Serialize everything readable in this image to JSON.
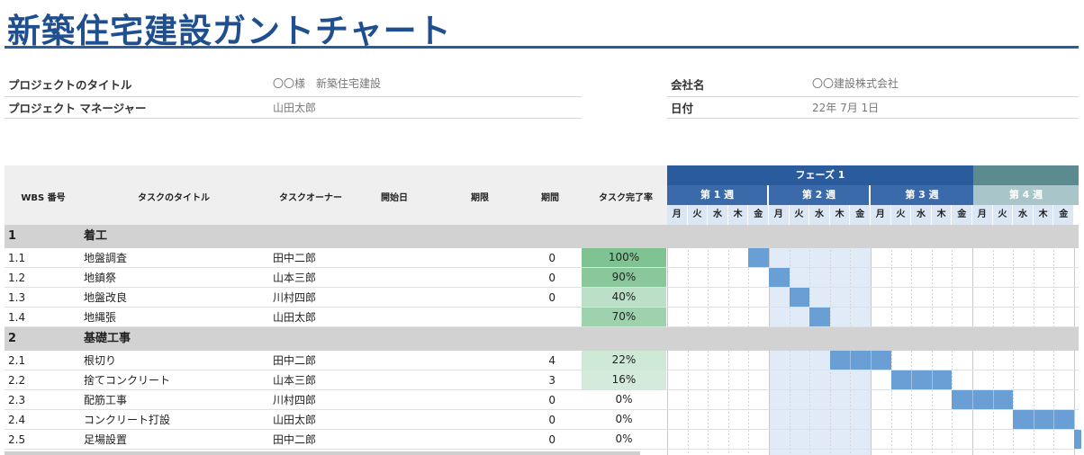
{
  "title": "新築住宅建設ガントチャート",
  "info": {
    "project_title_label": "プロジェクトのタイトル",
    "project_title_value": "〇〇様　新築住宅建設",
    "manager_label": "プロジェクト マネージャー",
    "manager_value": "山田太郎",
    "company_label": "会社名",
    "company_value": "〇〇建設株式会社",
    "date_label": "日付",
    "date_value": "22年 7月 1日"
  },
  "columns": {
    "wbs": "WBS 番号",
    "task": "タスクのタイトル",
    "owner": "タスクオーナー",
    "start": "開始日",
    "due": "期限",
    "duration": "期間",
    "progress": "タスク完了率"
  },
  "gantt": {
    "phase1": "フェーズ 1",
    "weeks": [
      "第 1 週",
      "第 2 週",
      "第 3 週",
      "第 4 週"
    ],
    "days": [
      "月",
      "火",
      "水",
      "木",
      "金"
    ]
  },
  "colors": {
    "title": "#1f4f8f",
    "phase1": "#2a5b9c",
    "phase2": "#5b8a8f",
    "bar": "#6a9fd6"
  },
  "rows": [
    {
      "type": "category",
      "wbs": "1",
      "task": "着工"
    },
    {
      "type": "task",
      "wbs": "1.1",
      "task": "地盤調査",
      "owner": "田中二郎",
      "duration": "0",
      "progress": "100%",
      "progress_value": 1.0,
      "bar_start": 4,
      "bar_len": 1
    },
    {
      "type": "task",
      "wbs": "1.2",
      "task": "地鎮祭",
      "owner": "山本三郎",
      "duration": "0",
      "progress": "90%",
      "progress_value": 0.9,
      "bar_start": 5,
      "bar_len": 1
    },
    {
      "type": "task",
      "wbs": "1.3",
      "task": "地盤改良",
      "owner": "川村四郎",
      "duration": "0",
      "progress": "40%",
      "progress_value": 0.4,
      "bar_start": 6,
      "bar_len": 1
    },
    {
      "type": "task",
      "wbs": "1.4",
      "task": "地縄張",
      "owner": "山田太郎",
      "duration": "",
      "progress": "70%",
      "progress_value": 0.7,
      "bar_start": 7,
      "bar_len": 1
    },
    {
      "type": "category",
      "wbs": "2",
      "task": "基礎工事"
    },
    {
      "type": "task",
      "wbs": "2.1",
      "task": "根切り",
      "owner": "田中二郎",
      "duration": "4",
      "progress": "22%",
      "progress_value": 0.22,
      "bar_start": 8,
      "bar_len": 3
    },
    {
      "type": "task",
      "wbs": "2.2",
      "task": "捨てコンクリート",
      "owner": "山本三郎",
      "duration": "3",
      "progress": "16%",
      "progress_value": 0.16,
      "bar_start": 11,
      "bar_len": 3
    },
    {
      "type": "task",
      "wbs": "2.3",
      "task": "配筋工事",
      "owner": "川村四郎",
      "duration": "0",
      "progress": "0%",
      "progress_value": 0.0,
      "bar_start": 14,
      "bar_len": 3
    },
    {
      "type": "task",
      "wbs": "2.4",
      "task": "コンクリート打設",
      "owner": "山田太郎",
      "duration": "0",
      "progress": "0%",
      "progress_value": 0.0,
      "bar_start": 17,
      "bar_len": 3
    },
    {
      "type": "task",
      "wbs": "2.5",
      "task": "足場設置",
      "owner": "田中二郎",
      "duration": "0",
      "progress": "0%",
      "progress_value": 0.0,
      "bar_start": 20,
      "bar_len": 1
    }
  ]
}
